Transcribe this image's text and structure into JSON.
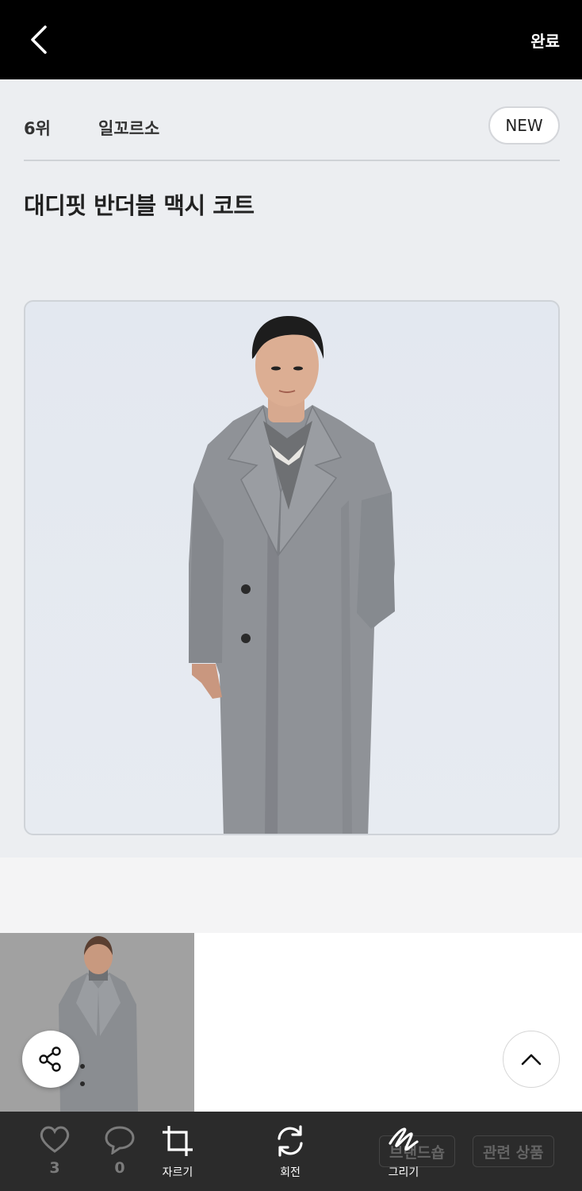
{
  "header": {
    "back_icon": "chevron-left-icon",
    "done_label": "완료"
  },
  "card": {
    "rank": "6위",
    "brand": "일꼬르소",
    "badge": "NEW",
    "title": "대디핏 반더블 맥시 코트"
  },
  "floating": {
    "share_icon": "share-icon",
    "top_icon": "chevron-up-icon"
  },
  "behind": {
    "likes": "3",
    "comments": "0",
    "brand_shop_label": "브랜드숍",
    "related_label": "관련 상품"
  },
  "toolbar": {
    "tools": [
      {
        "label": "자르기",
        "icon": "crop-icon"
      },
      {
        "label": "회전",
        "icon": "rotate-icon"
      },
      {
        "label": "그리기",
        "icon": "draw-icon"
      }
    ]
  },
  "colors": {
    "topbar": "#000000",
    "toolbar": "#2b2b2b",
    "card_bg": "#eceef1",
    "coat": "#8f9297"
  }
}
